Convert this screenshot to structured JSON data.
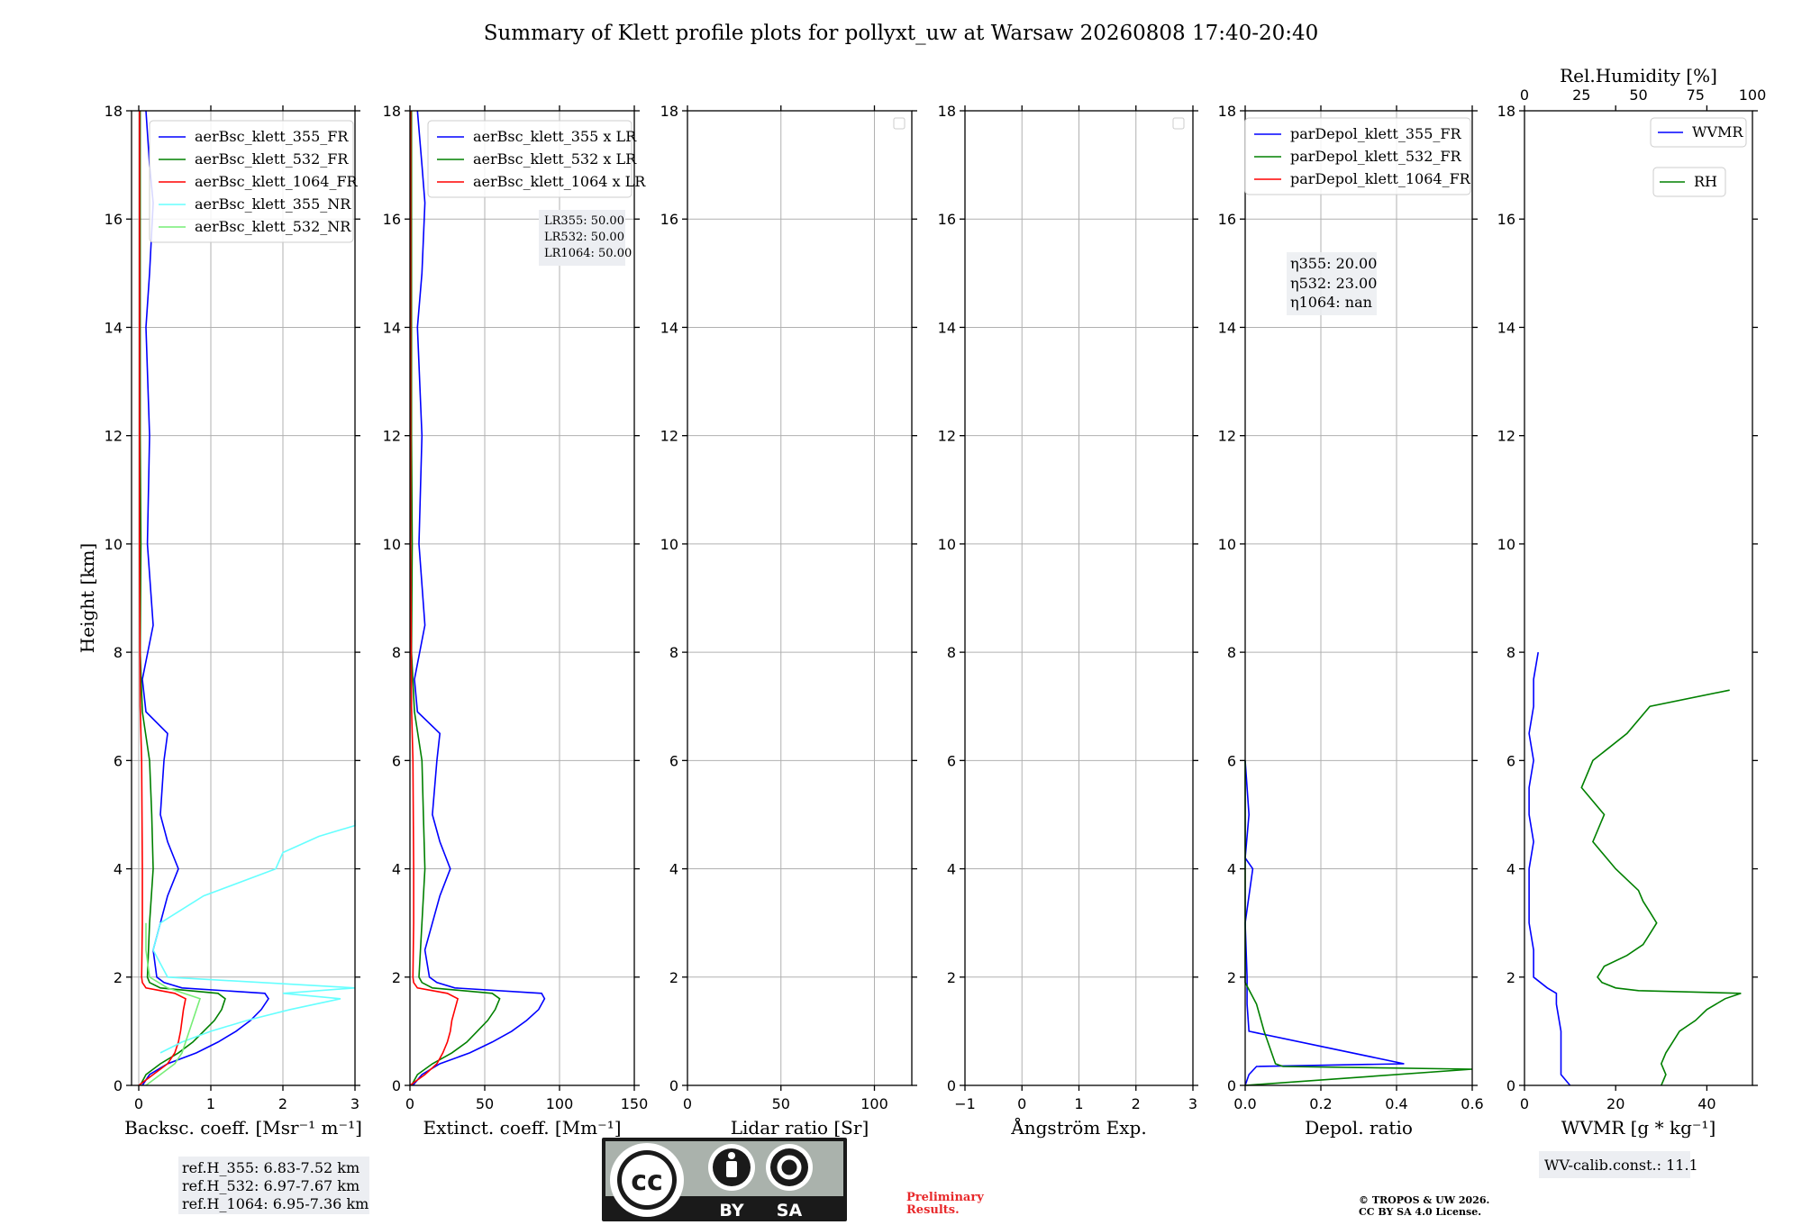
{
  "title": "Summary of Klett profile plots for pollyxt_uw at Warsaw 20260808 17:40-20:40",
  "chart_data": [
    {
      "type": "line",
      "panel": "backscatter",
      "xlabel": "Backsc. coeff. [Msr⁻¹ m⁻¹]",
      "ylabel": "Height [km]",
      "xlim": [
        -0.1,
        3
      ],
      "ylim": [
        0,
        18
      ],
      "xticks": [
        "0",
        "1",
        "2",
        "3"
      ],
      "xtick_values": [
        0,
        1,
        2,
        3
      ],
      "yticks": [
        "0",
        "2",
        "4",
        "6",
        "8",
        "10",
        "12",
        "14",
        "16",
        "18"
      ],
      "grid": true,
      "legend_position": "top-right",
      "series": [
        {
          "name": "aerBsc_klett_355_FR",
          "color": "#0000ff",
          "y": [
            0,
            0.2,
            0.4,
            0.6,
            0.8,
            1.0,
            1.2,
            1.4,
            1.6,
            1.7,
            1.8,
            1.9,
            2.0,
            2.5,
            3.0,
            3.5,
            4.0,
            4.5,
            5.0,
            6.0,
            6.5,
            6.9,
            7.5,
            8.5,
            10,
            12,
            14,
            15,
            16.3,
            17,
            18
          ],
          "x": [
            0.05,
            0.15,
            0.4,
            0.8,
            1.1,
            1.35,
            1.55,
            1.7,
            1.8,
            1.75,
            0.6,
            0.35,
            0.25,
            0.2,
            0.3,
            0.4,
            0.55,
            0.4,
            0.3,
            0.35,
            0.4,
            0.1,
            0.05,
            0.2,
            0.12,
            0.15,
            0.1,
            0.15,
            0.2,
            0.15,
            0.1
          ]
        },
        {
          "name": "aerBsc_klett_532_FR",
          "color": "#008000",
          "y": [
            0,
            0.2,
            0.4,
            0.6,
            0.8,
            1.0,
            1.2,
            1.4,
            1.6,
            1.7,
            1.8,
            1.9,
            2.0,
            3.0,
            4.0,
            5.0,
            6.0,
            6.9,
            8,
            10,
            12,
            14,
            16,
            18
          ],
          "x": [
            0.02,
            0.1,
            0.3,
            0.55,
            0.75,
            0.9,
            1.05,
            1.15,
            1.2,
            1.1,
            0.3,
            0.15,
            0.12,
            0.15,
            0.2,
            0.18,
            0.15,
            0.05,
            0.02,
            0.03,
            0.02,
            0.02,
            0.02,
            0.02
          ]
        },
        {
          "name": "aerBsc_klett_1064_FR",
          "color": "#ff0000",
          "y": [
            0,
            0.1,
            0.2,
            0.4,
            0.6,
            0.8,
            1.0,
            1.2,
            1.4,
            1.6,
            1.7,
            1.8,
            1.9,
            2.0,
            3.0,
            4.0,
            6.0,
            7.0,
            10,
            14,
            18
          ],
          "x": [
            0.0,
            0.1,
            0.2,
            0.4,
            0.5,
            0.55,
            0.58,
            0.6,
            0.62,
            0.65,
            0.5,
            0.1,
            0.05,
            0.04,
            0.05,
            0.05,
            0.04,
            0.02,
            0.01,
            0.01,
            0.01
          ]
        },
        {
          "name": "aerBsc_klett_355_NR",
          "color": "#66ffff",
          "y": [
            0.6,
            0.8,
            1.0,
            1.2,
            1.4,
            1.6,
            1.7,
            1.8,
            2.0,
            2.5,
            3.0,
            3.5,
            4.0,
            4.3,
            4.6,
            4.8,
            4.9
          ],
          "x": [
            0.3,
            0.6,
            1.0,
            1.5,
            2.1,
            2.8,
            2.0,
            3.0,
            0.4,
            0.2,
            0.3,
            0.9,
            1.9,
            2.0,
            2.5,
            3.0,
            3.0
          ]
        },
        {
          "name": "aerBsc_klett_532_NR",
          "color": "#77ee77",
          "y": [
            0,
            0.2,
            0.4,
            0.6,
            0.8,
            1.0,
            1.2,
            1.4,
            1.6,
            1.8,
            2.0,
            2.5,
            3.0
          ],
          "x": [
            0.1,
            0.3,
            0.5,
            0.6,
            0.65,
            0.7,
            0.75,
            0.8,
            0.85,
            0.4,
            0.15,
            0.1,
            0.1
          ]
        }
      ],
      "text_box": [
        "ref.H_355: 6.83-7.52 km",
        "ref.H_532: 6.97-7.67 km",
        "ref.H_1064: 6.95-7.36 km"
      ]
    },
    {
      "type": "line",
      "panel": "extinction",
      "xlabel": "Extinct. coeff. [Mm⁻¹]",
      "xlim": [
        0,
        150
      ],
      "ylim": [
        0,
        18
      ],
      "xticks": [
        "0",
        "50",
        "100",
        "150"
      ],
      "xtick_values": [
        0,
        50,
        100,
        150
      ],
      "yticks": [
        "0",
        "2",
        "4",
        "6",
        "8",
        "10",
        "12",
        "14",
        "16",
        "18"
      ],
      "grid": true,
      "legend_position": "top-right",
      "series": [
        {
          "name": "aerBsc_klett_355 x LR",
          "color": "#0000ff",
          "y": [
            0,
            0.2,
            0.4,
            0.6,
            0.8,
            1.0,
            1.2,
            1.4,
            1.6,
            1.7,
            1.8,
            1.9,
            2.0,
            2.5,
            3.0,
            3.5,
            4.0,
            4.5,
            5.0,
            6.0,
            6.5,
            6.9,
            7.5,
            8.5,
            10,
            12,
            14,
            15,
            16.3,
            17,
            18
          ],
          "x": [
            2,
            8,
            20,
            40,
            55,
            68,
            78,
            86,
            90,
            88,
            30,
            18,
            13,
            10,
            15,
            20,
            27,
            20,
            15,
            18,
            20,
            5,
            3,
            10,
            6,
            8,
            5,
            8,
            10,
            8,
            5
          ]
        },
        {
          "name": "aerBsc_klett_532 x LR",
          "color": "#008000",
          "y": [
            0,
            0.2,
            0.4,
            0.6,
            0.8,
            1.0,
            1.2,
            1.4,
            1.6,
            1.7,
            1.8,
            1.9,
            2.0,
            3.0,
            4.0,
            5.0,
            6.0,
            6.9,
            8,
            10,
            12,
            14,
            16,
            18
          ],
          "x": [
            1,
            5,
            15,
            28,
            38,
            45,
            52,
            57,
            60,
            55,
            15,
            8,
            6,
            8,
            10,
            9,
            8,
            3,
            1,
            1.5,
            1,
            1,
            1,
            1
          ]
        },
        {
          "name": "aerBsc_klett_1064 x LR",
          "color": "#ff0000",
          "y": [
            0,
            0.1,
            0.2,
            0.4,
            0.6,
            0.8,
            1.0,
            1.2,
            1.4,
            1.6,
            1.7,
            1.8,
            1.9,
            2.0,
            3.0,
            4.0,
            6.0,
            7.0,
            10,
            14,
            18
          ],
          "x": [
            0,
            5,
            10,
            18,
            22,
            25,
            27,
            28,
            30,
            32,
            25,
            5,
            2.5,
            2,
            2.5,
            2.5,
            2,
            1,
            0.5,
            0.5,
            0.5
          ]
        }
      ],
      "text_box": [
        "LR355: 50.00",
        "LR532: 50.00",
        "LR1064: 50.00"
      ]
    },
    {
      "type": "line",
      "panel": "lidar-ratio",
      "xlabel": "Lidar ratio [Sr]",
      "xlim": [
        0,
        120
      ],
      "ylim": [
        0,
        18
      ],
      "xticks": [
        "0",
        "50",
        "100"
      ],
      "xtick_values": [
        0,
        50,
        100
      ],
      "yticks": [
        "0",
        "2",
        "4",
        "6",
        "8",
        "10",
        "12",
        "14",
        "16",
        "18"
      ],
      "grid": true,
      "legend_position": "top-right",
      "series": []
    },
    {
      "type": "line",
      "panel": "angstrom",
      "xlabel": "Ångström Exp.",
      "xlim": [
        -1,
        3
      ],
      "ylim": [
        0,
        18
      ],
      "xticks": [
        "−1",
        "0",
        "1",
        "2",
        "3"
      ],
      "xtick_values": [
        -1,
        0,
        1,
        2,
        3
      ],
      "yticks": [
        "0",
        "2",
        "4",
        "6",
        "8",
        "10",
        "12",
        "14",
        "16",
        "18"
      ],
      "grid": true,
      "legend_position": "top-right",
      "series": []
    },
    {
      "type": "line",
      "panel": "depolarization",
      "xlabel": "Depol. ratio",
      "xlim": [
        0,
        0.6
      ],
      "ylim": [
        0,
        18
      ],
      "xticks": [
        "0.0",
        "0.2",
        "0.4",
        "0.6"
      ],
      "xtick_values": [
        0,
        0.2,
        0.4,
        0.6
      ],
      "yticks": [
        "0",
        "2",
        "4",
        "6",
        "8",
        "10",
        "12",
        "14",
        "16",
        "18"
      ],
      "grid": true,
      "legend_position": "top-left",
      "series": [
        {
          "name": "parDepol_klett_355_FR",
          "color": "#0000ff",
          "y": [
            0,
            0.2,
            0.35,
            0.4,
            1.0,
            1.5,
            2.0,
            3.0,
            4.0,
            4.2,
            5.0,
            6.0
          ],
          "x": [
            0.0,
            0.01,
            0.03,
            0.42,
            0.01,
            0.005,
            0.005,
            0.0,
            0.02,
            0.0,
            0.01,
            0.0
          ]
        },
        {
          "name": "parDepol_klett_532_FR",
          "color": "#008000",
          "y": [
            0,
            0.3,
            0.35,
            0.4,
            1.0,
            1.5,
            1.9,
            2.5,
            4.0,
            6.0
          ],
          "x": [
            0.0,
            0.6,
            0.1,
            0.08,
            0.05,
            0.03,
            0.0,
            0.0,
            0.0,
            0.0
          ]
        },
        {
          "name": "parDepol_klett_1064_FR",
          "color": "#ff0000",
          "y": [],
          "x": []
        }
      ],
      "text_box": [
        "η355: 20.00",
        "η532: 23.00",
        "η1064: nan"
      ]
    },
    {
      "type": "line",
      "panel": "water-vapor",
      "xlabel": "WVMR [g * kg⁻¹]",
      "top_xlabel": "Rel.Humidity [%]",
      "xlim": [
        0,
        50
      ],
      "top_xlim": [
        0,
        100
      ],
      "ylim": [
        0,
        18
      ],
      "xticks": [
        "0",
        "20",
        "40"
      ],
      "xtick_values": [
        0,
        20,
        40
      ],
      "top_xticks": [
        "0",
        "25",
        "50",
        "75",
        "100"
      ],
      "top_xtick_values": [
        0,
        25,
        50,
        75,
        100
      ],
      "yticks": [
        "0",
        "2",
        "4",
        "6",
        "8",
        "10",
        "12",
        "14",
        "16",
        "18"
      ],
      "grid": false,
      "series": [
        {
          "name": "WVMR",
          "color": "#0000ff",
          "y": [
            0,
            0.2,
            0.5,
            1.0,
            1.5,
            1.7,
            1.8,
            2.0,
            2.5,
            3.0,
            3.5,
            4.0,
            4.5,
            5.0,
            5.5,
            6.0,
            6.5,
            7.0,
            7.5,
            8.0
          ],
          "x": [
            10,
            8,
            8,
            8,
            7,
            7,
            5,
            2,
            2,
            1,
            1,
            1,
            2,
            1,
            1,
            2,
            1,
            2,
            2,
            3
          ]
        },
        {
          "name": "RH",
          "color": "#008000",
          "y": [
            0,
            0.2,
            0.4,
            0.6,
            0.8,
            1.0,
            1.2,
            1.4,
            1.6,
            1.7,
            1.75,
            1.8,
            1.9,
            2.0,
            2.2,
            2.4,
            2.6,
            2.8,
            3.0,
            3.2,
            3.4,
            3.6,
            3.8,
            4.0,
            4.5,
            5.0,
            5.5,
            6.0,
            6.5,
            7.0,
            7.3
          ],
          "x": [
            60,
            62,
            60,
            62,
            65,
            68,
            75,
            80,
            88,
            95,
            50,
            40,
            34,
            32,
            35,
            45,
            52,
            55,
            58,
            55,
            52,
            50,
            45,
            40,
            30,
            35,
            25,
            30,
            45,
            55,
            90
          ]
        }
      ],
      "text_box": [
        "WV-calib.const.: 11.1"
      ]
    }
  ],
  "notes": {
    "preliminary_line1": "Preliminary",
    "preliminary_line2": "Results.",
    "copyright_line1": "© TROPOS & UW 2026.",
    "copyright_line2": "CC BY SA 4.0 License."
  },
  "license_badge": {
    "cc": "cc",
    "by": "BY",
    "sa": "SA"
  }
}
